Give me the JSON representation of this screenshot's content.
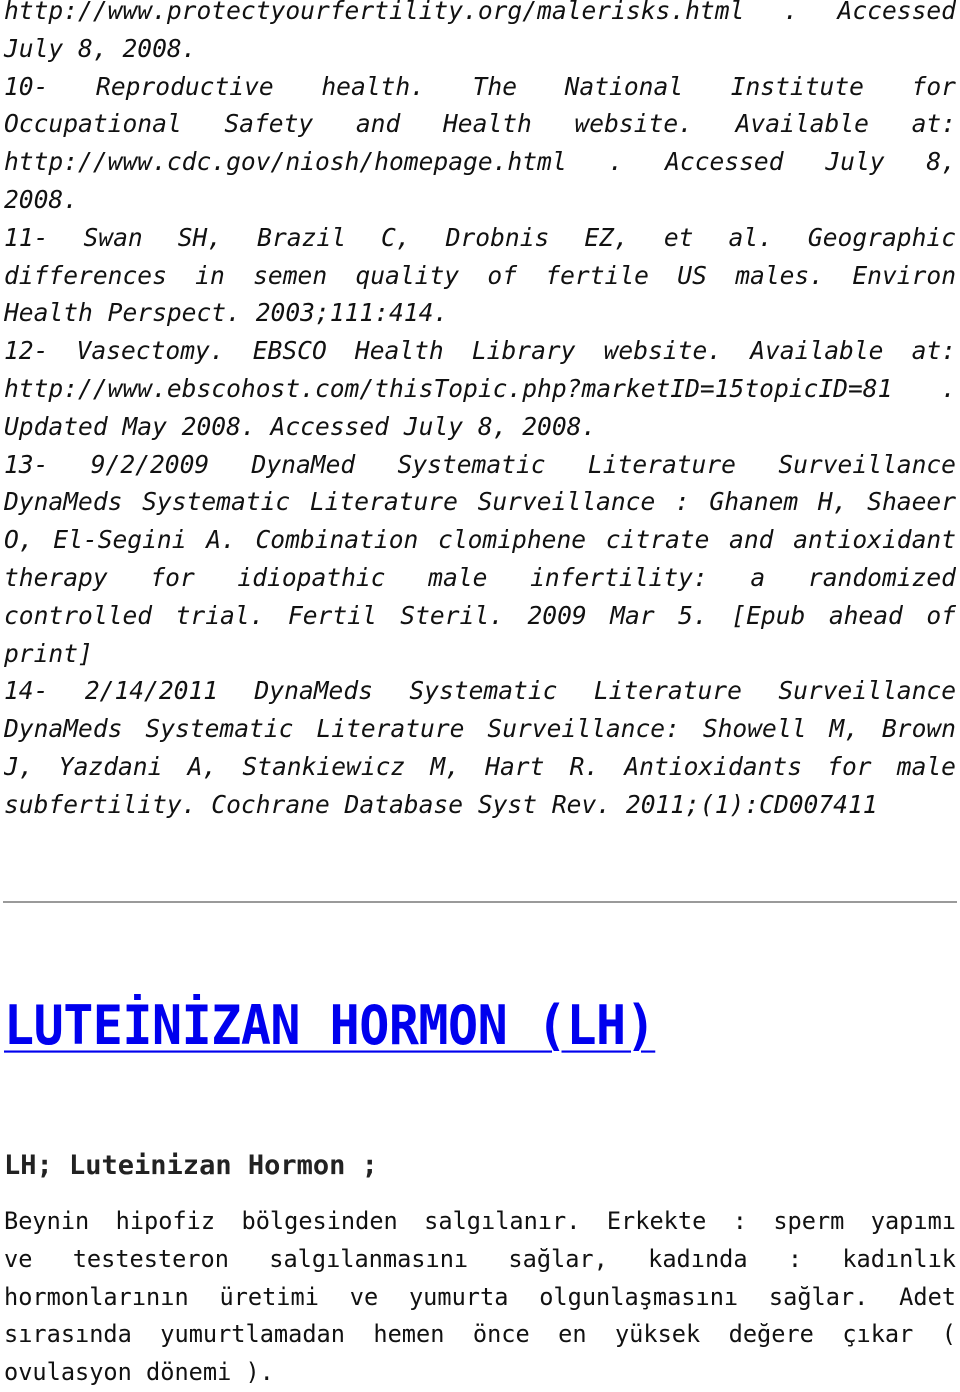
{
  "references": {
    "lines": [
      {
        "text": "http://www.protectyourfertility.org/malerisks.html . Accessed",
        "justify": true
      },
      {
        "text": "July 8, 2008.",
        "justify": false
      },
      {
        "text": "10- Reproductive health. The National Institute for",
        "justify": true
      },
      {
        "text": "Occupational Safety and Health website. Available at:",
        "justify": true
      },
      {
        "text": "http://www.cdc.gov/niosh/homepage.html . Accessed July 8,",
        "justify": true
      },
      {
        "text": "2008.",
        "justify": false
      },
      {
        "text": "11- Swan SH, Brazil C, Drobnis EZ, et al. Geographic",
        "justify": true
      },
      {
        "text": "differences in semen quality of fertile US males. Environ",
        "justify": true
      },
      {
        "text": "Health Perspect. 2003;111:414.",
        "justify": false
      },
      {
        "text": "12- Vasectomy. EBSCO Health Library website. Available at:",
        "justify": true
      },
      {
        "text": "http://www.ebscohost.com/thisTopic.php?marketID=15topicID=81 .",
        "justify": true
      },
      {
        "text": "Updated May 2008. Accessed July 8, 2008.",
        "justify": false
      },
      {
        "text": "13- 9/2/2009 DynaMed Systematic Literature Surveillance",
        "justify": true
      },
      {
        "text": "DynaMeds Systematic Literature Surveillance : Ghanem H, Shaeer",
        "justify": true
      },
      {
        "text": "O, El-Segini A. Combination clomiphene citrate and antioxidant",
        "justify": true
      },
      {
        "text": "therapy for idiopathic male infertility: a randomized",
        "justify": true
      },
      {
        "text": "controlled trial. Fertil Steril. 2009 Mar 5. [Epub ahead of",
        "justify": true
      },
      {
        "text": "print]",
        "justify": false
      },
      {
        "text": "14- 2/14/2011 DynaMeds Systematic Literature Surveillance",
        "justify": true
      },
      {
        "text": "DynaMeds Systematic Literature Surveillance: Showell M, Brown",
        "justify": true
      },
      {
        "text": "J, Yazdani A, Stankiewicz M, Hart R. Antioxidants for male",
        "justify": true
      },
      {
        "text": "subfertility. Cochrane Database Syst Rev. 2011;(1):CD007411",
        "justify": false
      }
    ]
  },
  "article": {
    "title": "LUTEİNİZAN HORMON (LH)",
    "title_color": "#0000ee",
    "subtitle": "LH; Luteinizan Hormon ;",
    "body_lines": [
      {
        "text": "Beynin hipofiz bölgesinden salgılanır. Erkekte : sperm yapımı",
        "justify": true
      },
      {
        "text": "ve testesteron salgılanmasını sağlar, kadında : kadınlık",
        "justify": true
      },
      {
        "text": "hormonlarının üretimi ve yumurta olgunlaşmasını sağlar. Adet",
        "justify": true
      },
      {
        "text": "sırasında yumurtlamadan hemen önce en yüksek değere çıkar (",
        "justify": true
      },
      {
        "text": "ovulasyon dönemi ).",
        "justify": false
      }
    ]
  }
}
